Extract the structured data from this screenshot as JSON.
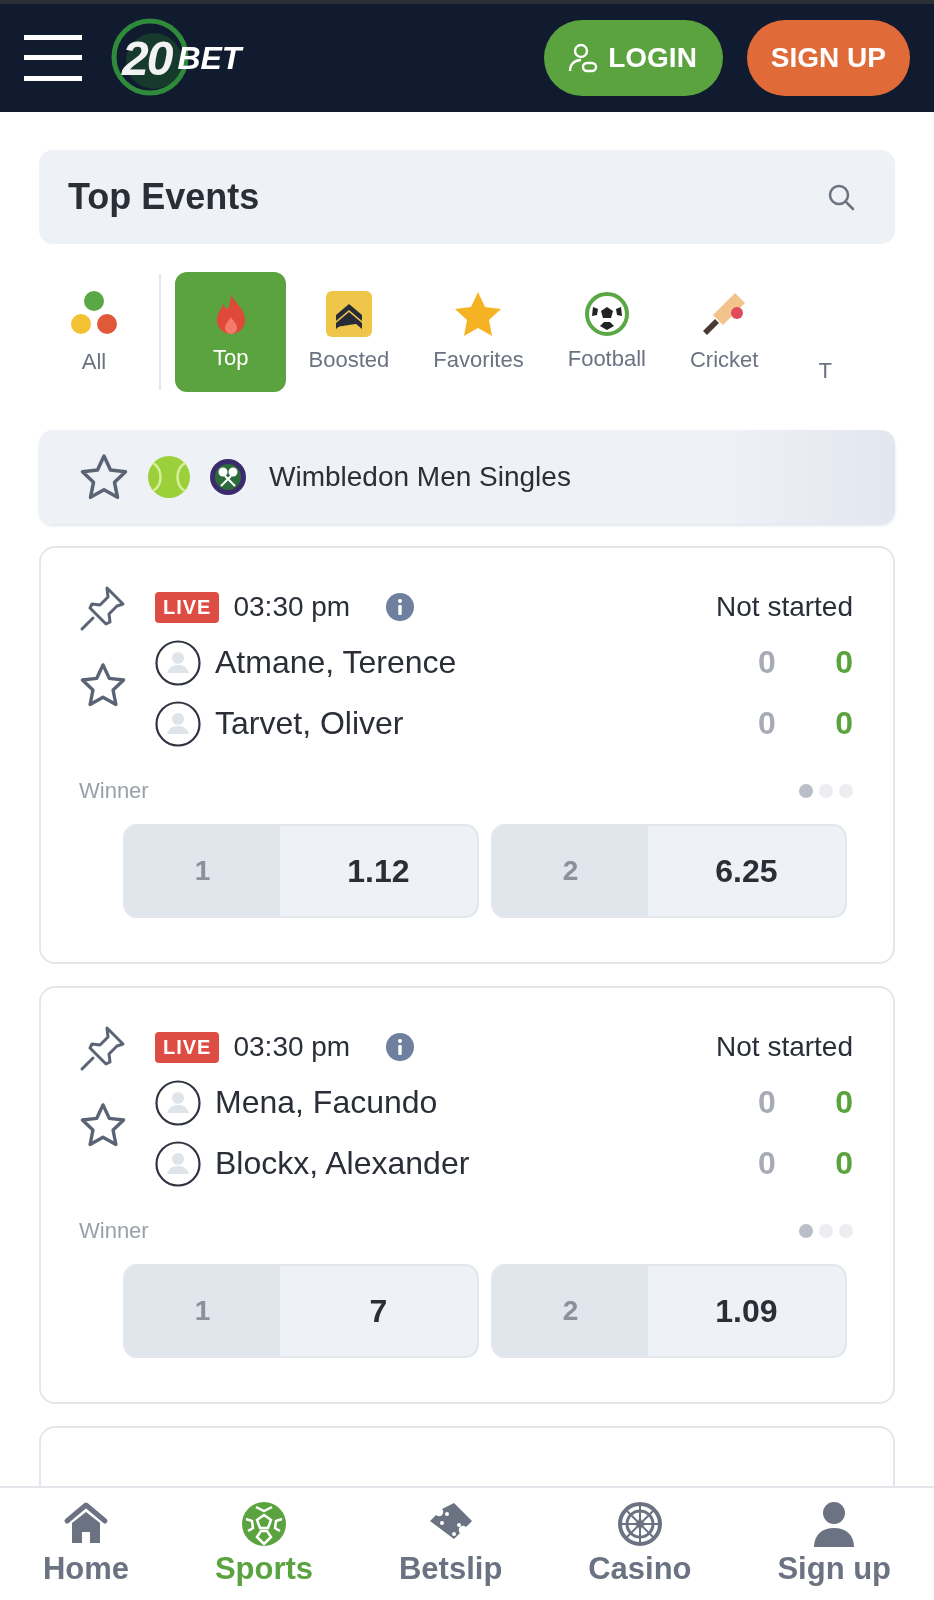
{
  "header": {
    "logo_number": "20",
    "logo_text": "BET",
    "login": "LOGIN",
    "signup": "SIGN UP"
  },
  "search_bar": {
    "title": "Top Events"
  },
  "categories": [
    {
      "label": "All",
      "kind": "all",
      "selected": false
    },
    {
      "label": "Top",
      "kind": "top",
      "selected": true
    },
    {
      "label": "Boosted",
      "kind": "boosted",
      "selected": false
    },
    {
      "label": "Favorites",
      "kind": "favorites",
      "selected": false
    },
    {
      "label": "Football",
      "kind": "football",
      "selected": false
    },
    {
      "label": "Cricket",
      "kind": "cricket",
      "selected": false
    },
    {
      "label": "T",
      "kind": "cut",
      "selected": false
    }
  ],
  "league": {
    "name": "Wimbledon Men Singles"
  },
  "events": [
    {
      "live": "LIVE",
      "time": "03:30 pm",
      "status": "Not started",
      "players": [
        {
          "name": "Atmane, Terence",
          "score_1": "0",
          "score_2": "0"
        },
        {
          "name": "Tarvet, Oliver",
          "score_1": "0",
          "score_2": "0"
        }
      ],
      "market": "Winner",
      "pager": [
        {
          "selected": true
        },
        {
          "selected": false
        },
        {
          "selected": false
        }
      ],
      "odds": [
        {
          "label": "1",
          "value": "1.12"
        },
        {
          "label": "2",
          "value": "6.25"
        }
      ]
    },
    {
      "live": "LIVE",
      "time": "03:30 pm",
      "status": "Not started",
      "players": [
        {
          "name": "Mena, Facundo",
          "score_1": "0",
          "score_2": "0"
        },
        {
          "name": "Blockx, Alexander",
          "score_1": "0",
          "score_2": "0"
        }
      ],
      "market": "Winner",
      "pager": [
        {
          "selected": true
        },
        {
          "selected": false
        },
        {
          "selected": false
        }
      ],
      "odds": [
        {
          "label": "1",
          "value": "7"
        },
        {
          "label": "2",
          "value": "1.09"
        }
      ]
    }
  ],
  "bottom_nav": [
    {
      "label": "Home",
      "kind": "home",
      "selected": false
    },
    {
      "label": "Sports",
      "kind": "sports",
      "selected": true
    },
    {
      "label": "Betslip",
      "kind": "betslip",
      "selected": false
    },
    {
      "label": "Casino",
      "kind": "casino",
      "selected": false
    },
    {
      "label": "Sign up",
      "kind": "user",
      "selected": false
    }
  ]
}
